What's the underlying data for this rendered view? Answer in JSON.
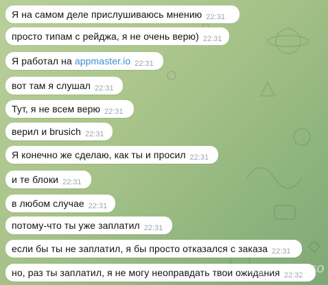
{
  "messages": [
    {
      "text": "Я на самом деле прислушиваюсь мнению",
      "time": "22:31"
    },
    {
      "text": "просто типам с рейджа, я не очень верю)",
      "time": "22:31"
    },
    {
      "prefix": "Я работал на ",
      "link": "appmaster.io",
      "time": "22:31"
    },
    {
      "text": "вот там я слушал",
      "time": "22:31"
    },
    {
      "text": "Тут, я не всем верю",
      "time": "22:31"
    },
    {
      "text": "верил и brusich",
      "time": "22:31"
    },
    {
      "text": "Я конечно же сделаю, как ты и просил",
      "time": "22:31"
    },
    {
      "text": "и те блоки",
      "time": "22:31"
    },
    {
      "text": "в любом случае",
      "time": "22:31"
    },
    {
      "text": "потому-что ты уже заплатил",
      "time": "22:31"
    },
    {
      "text": "если бы ты не заплатил, я бы просто отказался с заказа",
      "time": "22:31"
    },
    {
      "text": "но, раз ты заплатил, я не могу неоправдать твои ожидания",
      "time": "22:32"
    }
  ],
  "watermark": "ragemp.pro",
  "colors": {
    "bubble": "#ffffff",
    "link": "#3a8ed3",
    "time": "#9aa5ad"
  }
}
